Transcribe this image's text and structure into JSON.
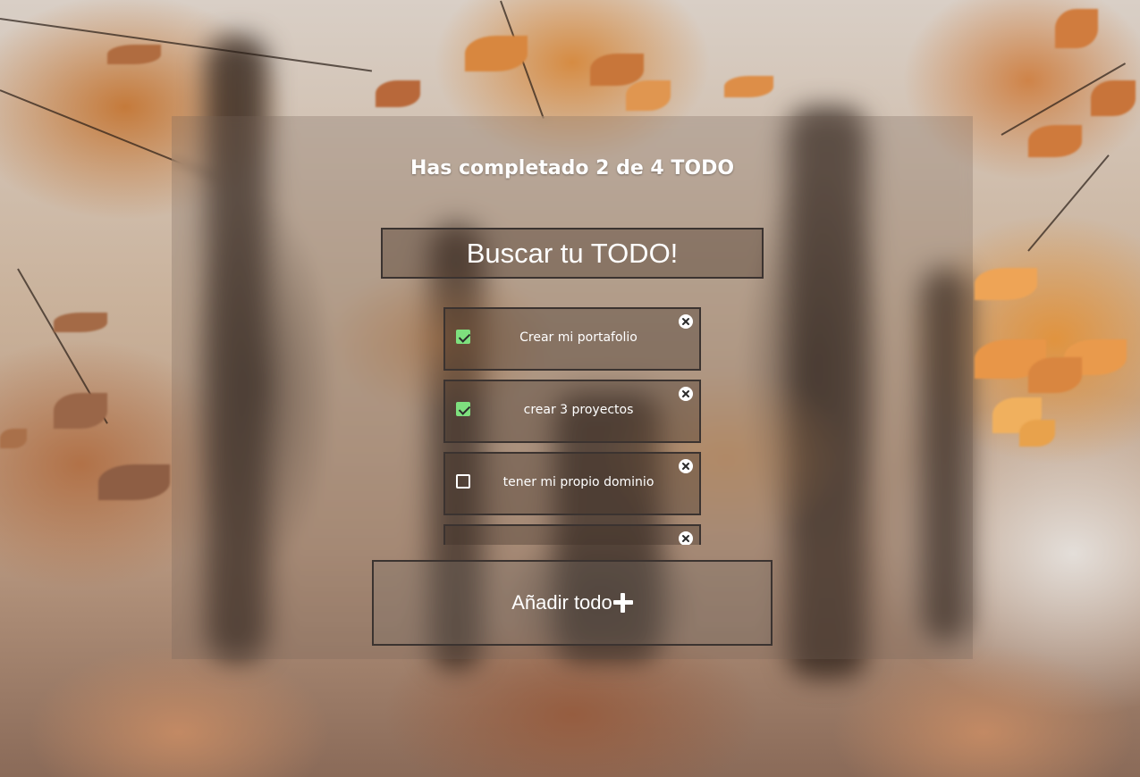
{
  "header": {
    "counter_text": "Has completado 2 de 4 TODO"
  },
  "search": {
    "placeholder": "Buscar tu TODO!"
  },
  "todos": [
    {
      "text": "Crear mi portafolio",
      "completed": true
    },
    {
      "text": "crear 3 proyectos",
      "completed": true
    },
    {
      "text": "tener mi propio dominio",
      "completed": false
    },
    {
      "text": "",
      "completed": false
    }
  ],
  "actions": {
    "add_label": "Añadir todo"
  },
  "icons": {
    "delete": "close-circle-icon",
    "add": "plus-icon",
    "checkbox": "checkbox-icon"
  },
  "colors": {
    "checked": "#7ee07e",
    "text": "#ffffff",
    "border": "#3b3330"
  }
}
